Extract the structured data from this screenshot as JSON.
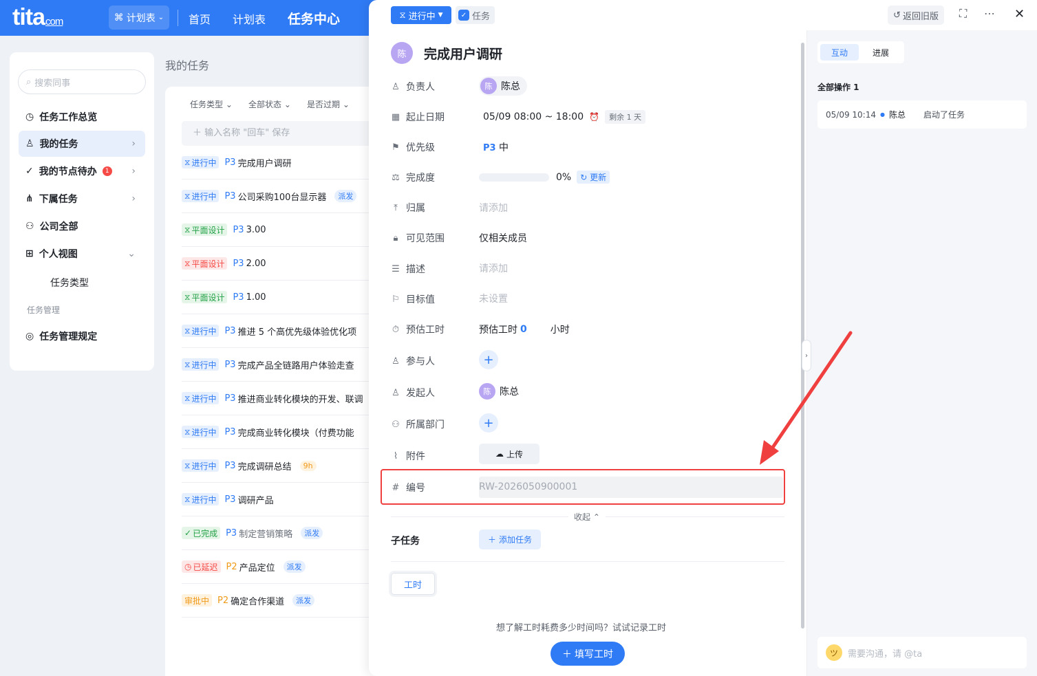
{
  "nav": {
    "logo": "tita",
    "logo_suffix": "com",
    "switch_label": "计划表",
    "links": [
      "首页",
      "计划表",
      "任务中心"
    ],
    "primary_color": "#2f7bf5"
  },
  "sidebar": {
    "search_placeholder": "搜索同事",
    "items": [
      {
        "label": "任务工作总览",
        "icon": "clock-check-icon"
      },
      {
        "label": "我的任务",
        "icon": "person-icon"
      },
      {
        "label": "我的节点待办",
        "icon": "check-circle-icon",
        "badge": "1"
      },
      {
        "label": "下属任务",
        "icon": "subtree-icon"
      },
      {
        "label": "公司全部",
        "icon": "org-chart-icon"
      },
      {
        "label": "个人视图",
        "icon": "grid-icon"
      }
    ],
    "sub_item": "任务类型",
    "group_label": "任务管理",
    "rules_item": "任务管理规定"
  },
  "list": {
    "page_title": "我的任务",
    "filters": [
      "任务类型",
      "全部状态",
      "是否过期"
    ],
    "quick_add_placeholder": "输入名称 \"回车\" 保存",
    "tasks": [
      {
        "status": "进行中",
        "color": "blue",
        "prio": "P3",
        "name": "完成用户调研"
      },
      {
        "status": "进行中",
        "color": "blue",
        "prio": "P3",
        "name": "公司采购100台显示器",
        "extra": "派发"
      },
      {
        "status": "平面设计",
        "color": "green",
        "prio": "P3",
        "name": "3.00"
      },
      {
        "status": "平面设计",
        "color": "red",
        "prio": "P3",
        "name": "2.00"
      },
      {
        "status": "平面设计",
        "color": "green",
        "prio": "P3",
        "name": "1.00"
      },
      {
        "status": "进行中",
        "color": "blue",
        "prio": "P3",
        "name": "推进 5 个高优先级体验优化项"
      },
      {
        "status": "进行中",
        "color": "blue",
        "prio": "P3",
        "name": "完成产品全链路用户体验走查"
      },
      {
        "status": "进行中",
        "color": "blue",
        "prio": "P3",
        "name": "推进商业转化模块的开发、联调"
      },
      {
        "status": "进行中",
        "color": "blue",
        "prio": "P3",
        "name": "完成商业转化模块（付费功能"
      },
      {
        "status": "进行中",
        "color": "blue",
        "prio": "P3",
        "name": "完成调研总结",
        "hours": "9h"
      },
      {
        "status": "进行中",
        "color": "blue",
        "prio": "P3",
        "name": "调研产品"
      },
      {
        "status": "已完成",
        "color": "green",
        "prio": "P3",
        "name": "制定营销策略",
        "extra": "派发",
        "muted": true
      },
      {
        "status": "已延迟",
        "color": "red",
        "prio": "P2",
        "name": "产品定位",
        "extra": "派发"
      },
      {
        "status": "审批中",
        "color": "orange",
        "prio": "P2",
        "name": "确定合作渠道",
        "extra": "派发"
      }
    ]
  },
  "detail": {
    "status_label": "进行中",
    "type_label": "任务",
    "back_old_label": "返回旧版",
    "avatar_char": "陈",
    "title": "完成用户调研",
    "fields": {
      "owner_label": "负责人",
      "owner": "陈总",
      "date_label": "起止日期",
      "date": "05/09 08:00 ~ 18:00",
      "remain": "剩余 1 天",
      "priority_label": "优先级",
      "priority_code": "P3",
      "priority_text": "中",
      "progress_label": "完成度",
      "progress": "0%",
      "progress_value": 0,
      "update_label": "更新",
      "parent_label": "归属",
      "parent": "请添加",
      "scope_label": "可见范围",
      "scope": "仅相关成员",
      "desc_label": "描述",
      "desc": "请添加",
      "target_label": "目标值",
      "target": "未设置",
      "estimate_label": "预估工时",
      "estimate_prefix": "预估工时",
      "estimate_value": "0",
      "estimate_unit": "小时",
      "participants_label": "参与人",
      "initiator_label": "发起人",
      "initiator": "陈总",
      "dept_label": "所属部门",
      "attach_label": "附件",
      "upload_label": "上传",
      "number_label": "编号",
      "number": "RW-2026050900001"
    },
    "collapse_label": "收起",
    "subtask_label": "子任务",
    "add_task_label": "添加任务",
    "hours_tab": "工时",
    "empty_tip": "想了解工时耗费多少时间吗？试试记录工时",
    "fill_hours_label": "填写工时"
  },
  "activity": {
    "tabs": [
      "互动",
      "进展"
    ],
    "ops_title": "全部操作 1",
    "log": {
      "time": "05/09 10:14",
      "user": "陈总",
      "action": "启动了任务"
    },
    "chat_placeholder": "需要沟通，请 @ta"
  },
  "highlight_color": "#ef3f3f"
}
